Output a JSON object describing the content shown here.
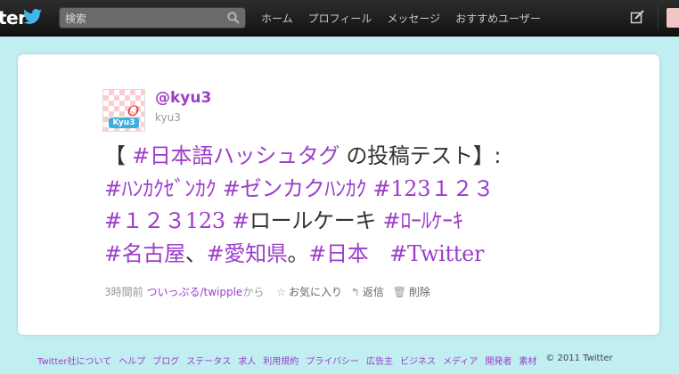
{
  "header": {
    "logo": "ter",
    "search_placeholder": "検索",
    "nav": [
      "ホーム",
      "プロフィール",
      "メッセージ",
      "おすすめユーザー"
    ]
  },
  "tweet": {
    "username": "@kyu3",
    "realname": "kyu3",
    "avatar_badge": "Kyu3",
    "avatar_letter": "O",
    "lines": [
      [
        {
          "t": "【 ",
          "tag": false
        },
        {
          "t": "#日本語ハッシュタグ",
          "tag": true
        },
        {
          "t": " の投稿テスト】:",
          "tag": false
        }
      ],
      [
        {
          "t": "#ﾊﾝｶｸｾﾞﾝｶｸ",
          "tag": true
        },
        {
          "t": " ",
          "tag": false
        },
        {
          "t": "#ゼンカクﾊﾝｶｸ",
          "tag": true
        },
        {
          "t": " ",
          "tag": false
        },
        {
          "t": "#123１２３",
          "tag": true,
          "serif": true
        }
      ],
      [
        {
          "t": "#１２３123",
          "tag": true,
          "serif": true
        },
        {
          "t": " ",
          "tag": false
        },
        {
          "t": "#",
          "tag": true
        },
        {
          "t": "ロールケーキ ",
          "tag": false
        },
        {
          "t": "#ﾛｰﾙｹｰｷ",
          "tag": true
        }
      ],
      [
        {
          "t": "#名古屋",
          "tag": true
        },
        {
          "t": "、",
          "tag": false
        },
        {
          "t": "#愛知県",
          "tag": true
        },
        {
          "t": "。",
          "tag": false
        },
        {
          "t": "#日本",
          "tag": true
        },
        {
          "t": "　",
          "tag": false
        },
        {
          "t": "#Twitter",
          "tag": true,
          "serif": true
        }
      ]
    ],
    "time": "3時間前",
    "source": "ついっぷる/twipple",
    "source_suffix": "から",
    "actions": {
      "favorite": "お気に入り",
      "reply": "返信",
      "delete": "削除"
    }
  },
  "footer": {
    "links": [
      "Twitter社について",
      "ヘルプ",
      "ブログ",
      "ステータス",
      "求人",
      "利用規約",
      "プライバシー",
      "広告主",
      "ビジネス",
      "メディア",
      "開発者",
      "素材"
    ],
    "copyright": "© 2011 Twitter"
  },
  "colors": {
    "accent": "#9c3ec8",
    "background": "#c0eef1",
    "topbar": "#1c1c1c"
  }
}
